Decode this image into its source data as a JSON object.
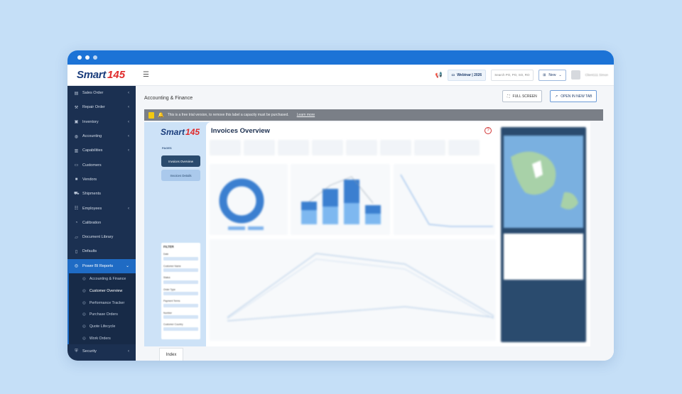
{
  "topbar": {
    "logo_word": "Smart",
    "logo_num": "145",
    "webinar_label": "Webinar | 2026",
    "search_placeholder": "Search PO, PO, SO, RO",
    "new_label": "New",
    "user_label": "Client111 Simon"
  },
  "sidebar": {
    "items": [
      {
        "label": "Sales Order",
        "icon": "cart-icon"
      },
      {
        "label": "Repair Order",
        "icon": "wrench-icon"
      },
      {
        "label": "Inventory",
        "icon": "box-icon"
      },
      {
        "label": "Accounting",
        "icon": "money-icon"
      },
      {
        "label": "Capabilities",
        "icon": "cap-icon"
      },
      {
        "label": "Customers",
        "icon": "users-icon"
      },
      {
        "label": "Vendors",
        "icon": "vendor-icon"
      },
      {
        "label": "Shipments",
        "icon": "truck-icon"
      },
      {
        "label": "Employees",
        "icon": "employee-icon"
      },
      {
        "label": "Calibration",
        "icon": "gauge-icon"
      },
      {
        "label": "Document Library",
        "icon": "folder-icon"
      },
      {
        "label": "Defaults",
        "icon": "doc-icon"
      },
      {
        "label": "Power BI Reports",
        "icon": "chart-icon"
      }
    ],
    "sub_items": [
      {
        "label": "Accounting & Finance"
      },
      {
        "label": "Customer Overview"
      },
      {
        "label": "Performance Tracker"
      },
      {
        "label": "Purchase Orders"
      },
      {
        "label": "Quote Lifecycle"
      },
      {
        "label": "Work Orders"
      }
    ],
    "security_label": "Security"
  },
  "main": {
    "breadcrumb": "Accounting & Finance",
    "full_screen_label": "FULL SCREEN",
    "open_new_tab_label": "OPEN IN NEW TAB",
    "trial_message": "This is a free trial version, to remove this label a capacity must be purchased.",
    "learn_more": "Learn more"
  },
  "report": {
    "logo_word": "Smart",
    "logo_num": "145",
    "pages_label": "PAGES",
    "page_buttons": [
      "Invoices Overview",
      "Invoices Details"
    ],
    "title": "Invoices Overview",
    "help_glyph": "?",
    "filter_title": "FILTER",
    "filter_labels": [
      "Date",
      "Customer Name",
      "Status",
      "Order Type",
      "Payment Terms",
      "Number",
      "Customer Country"
    ]
  },
  "tabs": {
    "index_label": "Index"
  },
  "colors": {
    "sidebar_bg": "#1b3051",
    "accent": "#1f6bc4",
    "report_bg": "#cde2f7",
    "powerbi_yellow": "#f2c811"
  }
}
